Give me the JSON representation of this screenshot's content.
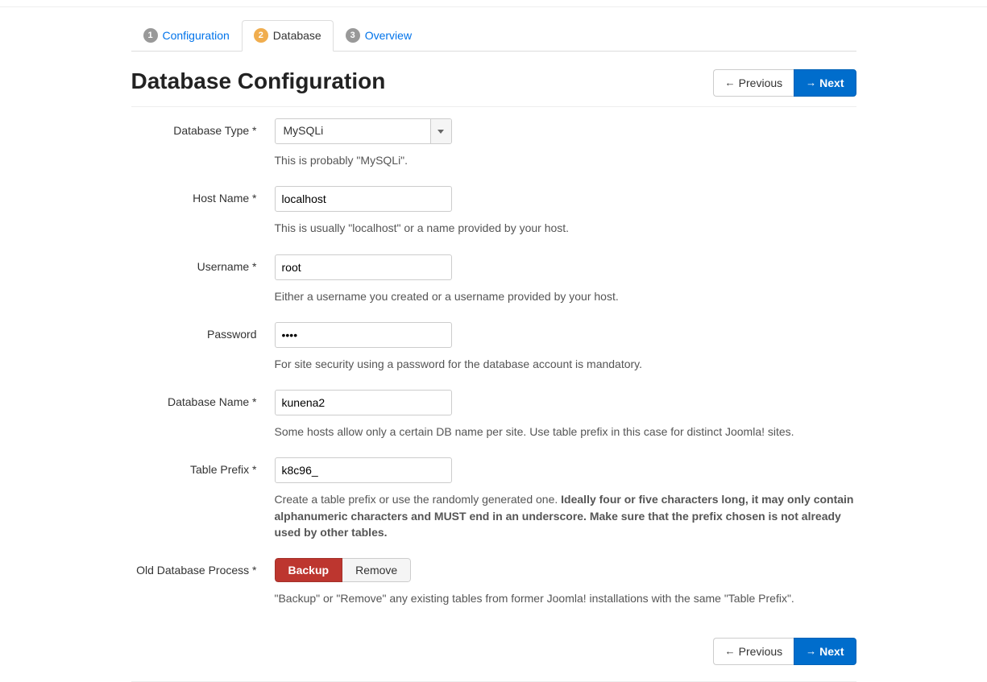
{
  "wizard": {
    "steps": [
      {
        "num": "1",
        "label": "Configuration",
        "active": false
      },
      {
        "num": "2",
        "label": "Database",
        "active": true
      },
      {
        "num": "3",
        "label": "Overview",
        "active": false
      }
    ]
  },
  "page_title": "Database Configuration",
  "nav": {
    "previous": "Previous",
    "next": "Next"
  },
  "form": {
    "db_type": {
      "label": "Database Type *",
      "value": "MySQLi",
      "help": "This is probably \"MySQLi\"."
    },
    "host_name": {
      "label": "Host Name *",
      "value": "localhost",
      "help": "This is usually \"localhost\" or a name provided by your host."
    },
    "username": {
      "label": "Username *",
      "value": "root",
      "help": "Either a username you created or a username provided by your host."
    },
    "password": {
      "label": "Password",
      "value": "••••",
      "help": "For site security using a password for the database account is mandatory."
    },
    "db_name": {
      "label": "Database Name *",
      "value": "kunena2",
      "help": "Some hosts allow only a certain DB name per site. Use table prefix in this case for distinct Joomla! sites."
    },
    "table_prefix": {
      "label": "Table Prefix *",
      "value": "k8c96_",
      "help_prefix": "Create a table prefix or use the randomly generated one. ",
      "help_strong": "Ideally four or five characters long, it may only contain alphanumeric characters and MUST end in an underscore. Make sure that the prefix chosen is not already used by other tables."
    },
    "old_db_process": {
      "label": "Old Database Process *",
      "option_backup": "Backup",
      "option_remove": "Remove",
      "help": "\"Backup\" or \"Remove\" any existing tables from former Joomla! installations with the same \"Table Prefix\"."
    }
  }
}
